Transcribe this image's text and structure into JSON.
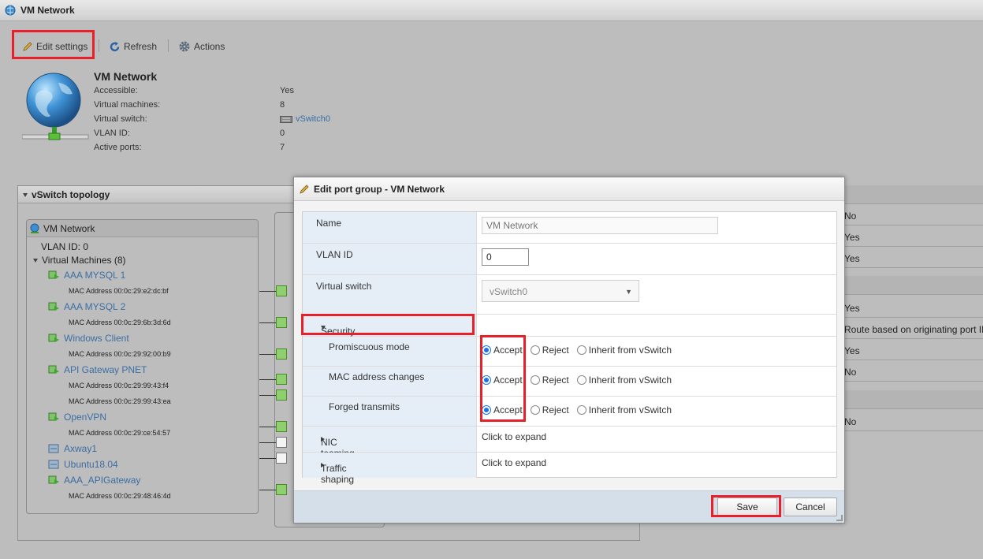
{
  "window": {
    "title": "VM Network"
  },
  "toolbar": {
    "edit_label": "Edit settings",
    "refresh_label": "Refresh",
    "actions_label": "Actions"
  },
  "info": {
    "title": "VM Network",
    "rows": [
      {
        "label": "Accessible:",
        "value": "Yes"
      },
      {
        "label": "Virtual machines:",
        "value": "8"
      },
      {
        "label": "Virtual switch:",
        "value": "vSwitch0"
      },
      {
        "label": "VLAN ID:",
        "value": "0"
      },
      {
        "label": "Active ports:",
        "value": "7"
      }
    ]
  },
  "topology": {
    "header": "vSwitch topology",
    "portgroup_name": "VM Network",
    "vlan_line": "VLAN ID: 0",
    "vms_line": "Virtual Machines (8)",
    "vms": [
      {
        "name": "AAA MYSQL 1",
        "mac": "MAC Address 00:0c:29:e2:dc:bf"
      },
      {
        "name": "AAA MYSQL 2",
        "mac": "MAC Address 00:0c:29:6b:3d:6d"
      },
      {
        "name": "Windows Client",
        "mac": "MAC Address 00:0c:29:92:00:b9"
      },
      {
        "name": "API Gateway PNET",
        "mac": "MAC Address 00:0c:29:99:43:f4"
      },
      {
        "name": "",
        "mac": "MAC Address 00:0c:29:99:43:ea"
      },
      {
        "name": "OpenVPN",
        "mac": "MAC Address 00:0c:29:ce:54:57"
      },
      {
        "name": "Axway1",
        "mac": ""
      },
      {
        "name": "Ubuntu18.04",
        "mac": ""
      },
      {
        "name": "AAA_APIGateway",
        "mac": "MAC Address 00:0c:29:48:46:4d"
      }
    ]
  },
  "right_panel": {
    "values": [
      "No",
      "Yes",
      "Yes",
      "Yes",
      "Route based on originating port ID",
      "Yes",
      "No",
      "No"
    ]
  },
  "modal": {
    "title": "Edit port group - VM Network",
    "name_label": "Name",
    "name_placeholder": "VM Network",
    "vlan_label": "VLAN ID",
    "vlan_value": "0",
    "vswitch_label": "Virtual switch",
    "vswitch_value": "vSwitch0",
    "security_label": "Security",
    "options": {
      "accept": "Accept",
      "reject": "Reject",
      "inherit": "Inherit from vSwitch"
    },
    "promiscuous_label": "Promiscuous mode",
    "mac_changes_label": "MAC address changes",
    "forged_label": "Forged transmits",
    "nic_teaming_label": "NIC teaming",
    "nic_teaming_value": "Click to expand",
    "traffic_shaping_label": "Traffic shaping",
    "traffic_shaping_value": "Click to expand",
    "save_label": "Save",
    "cancel_label": "Cancel"
  },
  "colors": {
    "highlight": "#e8202a",
    "link": "#3b6ea5",
    "label_bg": "#e5eef7",
    "footer_bg": "#d5dfe9"
  }
}
